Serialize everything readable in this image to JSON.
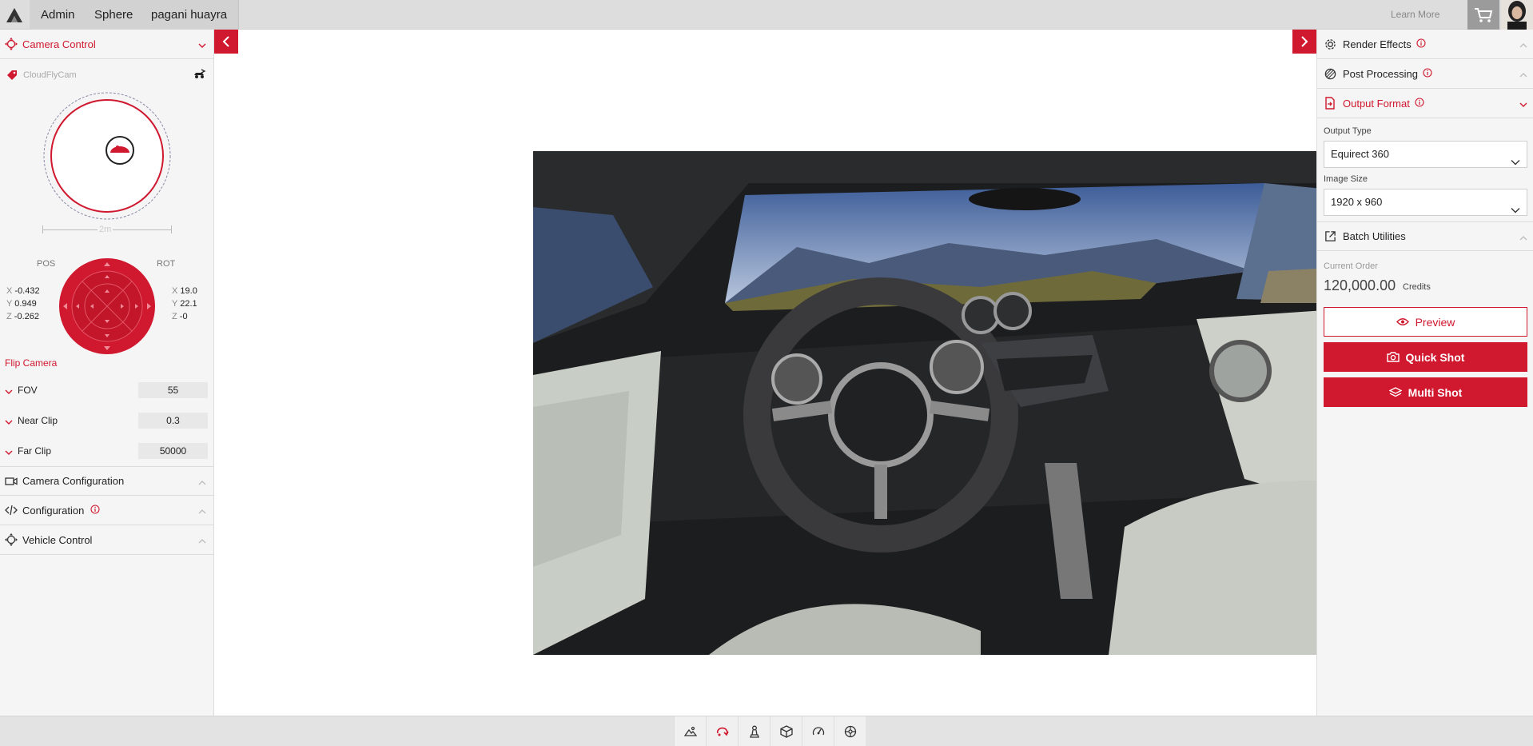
{
  "header": {
    "tabs": [
      "Admin",
      "Sphere",
      "pagani huayra"
    ],
    "learn_more": "Learn More",
    "icons": [
      "logo-icon",
      "cart-icon",
      "avatar"
    ]
  },
  "left_panel": {
    "camera_control": {
      "label": "Camera Control",
      "expanded": true
    },
    "camera_name": "CloudFlyCam",
    "scale_label": "2m",
    "pos_label": "POS",
    "rot_label": "ROT",
    "pos": {
      "x": "-0.432",
      "y": "0.949",
      "z": "-0.262"
    },
    "rot": {
      "x": "19.0",
      "y": "22.1",
      "z": "-0"
    },
    "axis_letters": {
      "x": "X",
      "y": "Y",
      "z": "Z"
    },
    "flip_camera": "Flip Camera",
    "params": [
      {
        "label": "FOV",
        "value": "55"
      },
      {
        "label": "Near Clip",
        "value": "0.3"
      },
      {
        "label": "Far Clip",
        "value": "50000"
      }
    ],
    "sections": [
      {
        "label": "Camera Configuration"
      },
      {
        "label": "Configuration"
      },
      {
        "label": "Vehicle Control"
      }
    ]
  },
  "right_panel": {
    "sections": [
      {
        "label": "Render Effects"
      },
      {
        "label": "Post Processing"
      },
      {
        "label": "Output Format"
      }
    ],
    "output_type_label": "Output Type",
    "output_type_value": "Equirect 360",
    "image_size_label": "Image Size",
    "image_size_value": "1920 x 960",
    "batch_utilities": "Batch Utilities",
    "current_order_label": "Current Order",
    "current_order_value": "120,000.00",
    "credits_label": "Credits",
    "buttons": {
      "preview": "Preview",
      "quick_shot": "Quick Shot",
      "multi_shot": "Multi Shot"
    }
  },
  "bottom_toolbar": {
    "tools": [
      "landscape-icon",
      "rotate-icon",
      "chess-piece-icon",
      "cube-icon",
      "speedometer-icon",
      "wheel-icon"
    ],
    "active": "rotate-icon"
  },
  "colors": {
    "accent": "#d0182f",
    "panel_bg": "#f5f5f5",
    "topbar_bg": "#dddddd"
  }
}
